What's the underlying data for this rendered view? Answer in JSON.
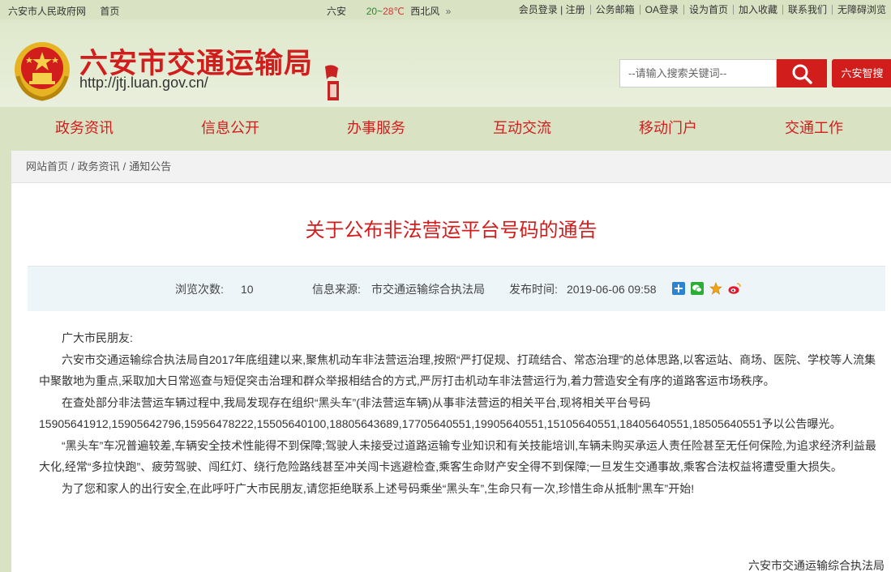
{
  "topbar": {
    "gov_site": "六安市人民政府网",
    "home": "首页",
    "weather_city": "六安",
    "temp_low": "20",
    "temp_sep": "~",
    "temp_high": "28℃",
    "wind": "西北风",
    "more": "»",
    "links": [
      "会员登录 | 注册",
      "公务邮箱",
      "OA登录",
      "设为首页",
      "加入收藏",
      "联系我们",
      "无障碍浏览"
    ]
  },
  "header": {
    "title": "六安市交通运输局",
    "url": "http://jtj.luan.gov.cn/",
    "search_placeholder": "--请输入搜索关键词--",
    "smart_search": "六安智搜"
  },
  "nav": [
    "政务资讯",
    "信息公开",
    "办事服务",
    "互动交流",
    "移动门户",
    "交通工作"
  ],
  "breadcrumb": [
    "网站首页",
    "政务资讯",
    "通知公告"
  ],
  "article": {
    "title": "关于公布非法营运平台号码的通告",
    "views_label": "浏览次数:",
    "views": "10",
    "source_label": "信息来源:",
    "source": "市交通运输综合执法局",
    "date_label": "发布时间:",
    "date": "2019-06-06 09:58",
    "paragraphs": [
      "广大市民朋友:",
      "六安市交通运输综合执法局自2017年底组建以来,聚焦机动车非法营运治理,按照“严打促规、打疏结合、常态治理”的总体思路,以客运站、商场、医院、学校等人流集中聚散地为重点,采取加大日常巡查与短促突击治理和群众举报相结合的方式,严厉打击机动车非法营运行为,着力营造安全有序的道路客运市场秩序。",
      "在查处部分非法营运车辆过程中,我局发现存在组织“黑头车”(非法营运车辆)从事非法营运的相关平台,现将相关平台号码15905641912,15905642796,15956478222,15505640100,18805643689,17705640551,19905640551,15105640551,18405640551,18505640551予以公告曝光。",
      "“黑头车”车况普遍较差,车辆安全技术性能得不到保障;驾驶人未接受过道路运输专业知识和有关技能培训,车辆未购买承运人责任险甚至无任何保险,为追求经济利益最大化,经常“多拉快跑”、疲劳驾驶、闯红灯、绕行危险路线甚至冲关闯卡逃避检查,乘客生命财产安全得不到保障;一旦发生交通事故,乘客合法权益将遭受重大损失。",
      "为了您和家人的出行安全,在此呼吁广大市民朋友,请您拒绝联系上述号码乘坐“黑头车”,生命只有一次,珍惜生命从抵制“黑车”开始!"
    ],
    "signature": "六安市交通运输综合执法局"
  },
  "colors": {
    "brand_red": "#d21d1d",
    "bg": "#d9e3c4",
    "meta_bg": "#eef5f9"
  }
}
